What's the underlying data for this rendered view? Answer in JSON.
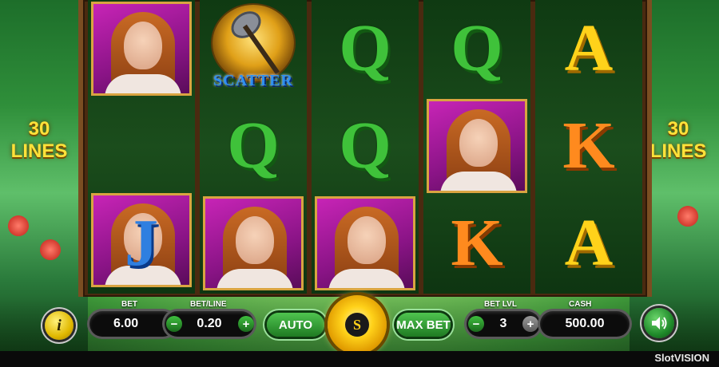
{
  "lines": {
    "left_count": "30",
    "left_word": "LINES",
    "right_count": "30",
    "right_word": "LINES"
  },
  "reels": [
    {
      "symbols": [
        "woman",
        "woman",
        "J"
      ]
    },
    {
      "symbols": [
        "scatter",
        "Q",
        "woman"
      ]
    },
    {
      "symbols": [
        "Q",
        "Q",
        "woman"
      ]
    },
    {
      "symbols": [
        "Q",
        "woman",
        "K"
      ]
    },
    {
      "symbols": [
        "A",
        "K",
        "A"
      ]
    }
  ],
  "scatter_label": "SCATTER",
  "controls": {
    "bet_label": "BET",
    "bet_value": "6.00",
    "bet_line_label": "BET/LINE",
    "bet_line_value": "0.20",
    "minus": "−",
    "plus": "+",
    "auto_label": "AUTO",
    "spin_symbol": "S",
    "max_bet_label": "MAX BET",
    "bet_level_label": "BET LVL",
    "bet_level_value": "3",
    "cash_label": "CASH",
    "cash_value": "500.00",
    "info_symbol": "i"
  },
  "brand": "SlotVISION",
  "colors": {
    "gold": "#ffd21a",
    "green": "#3fc23a",
    "orange": "#ff8a1e",
    "blue": "#2f7fe0",
    "magenta": "#c724b6"
  },
  "icons": {
    "info": "info-icon",
    "sound": "speaker-icon",
    "spin": "spin-icon"
  }
}
